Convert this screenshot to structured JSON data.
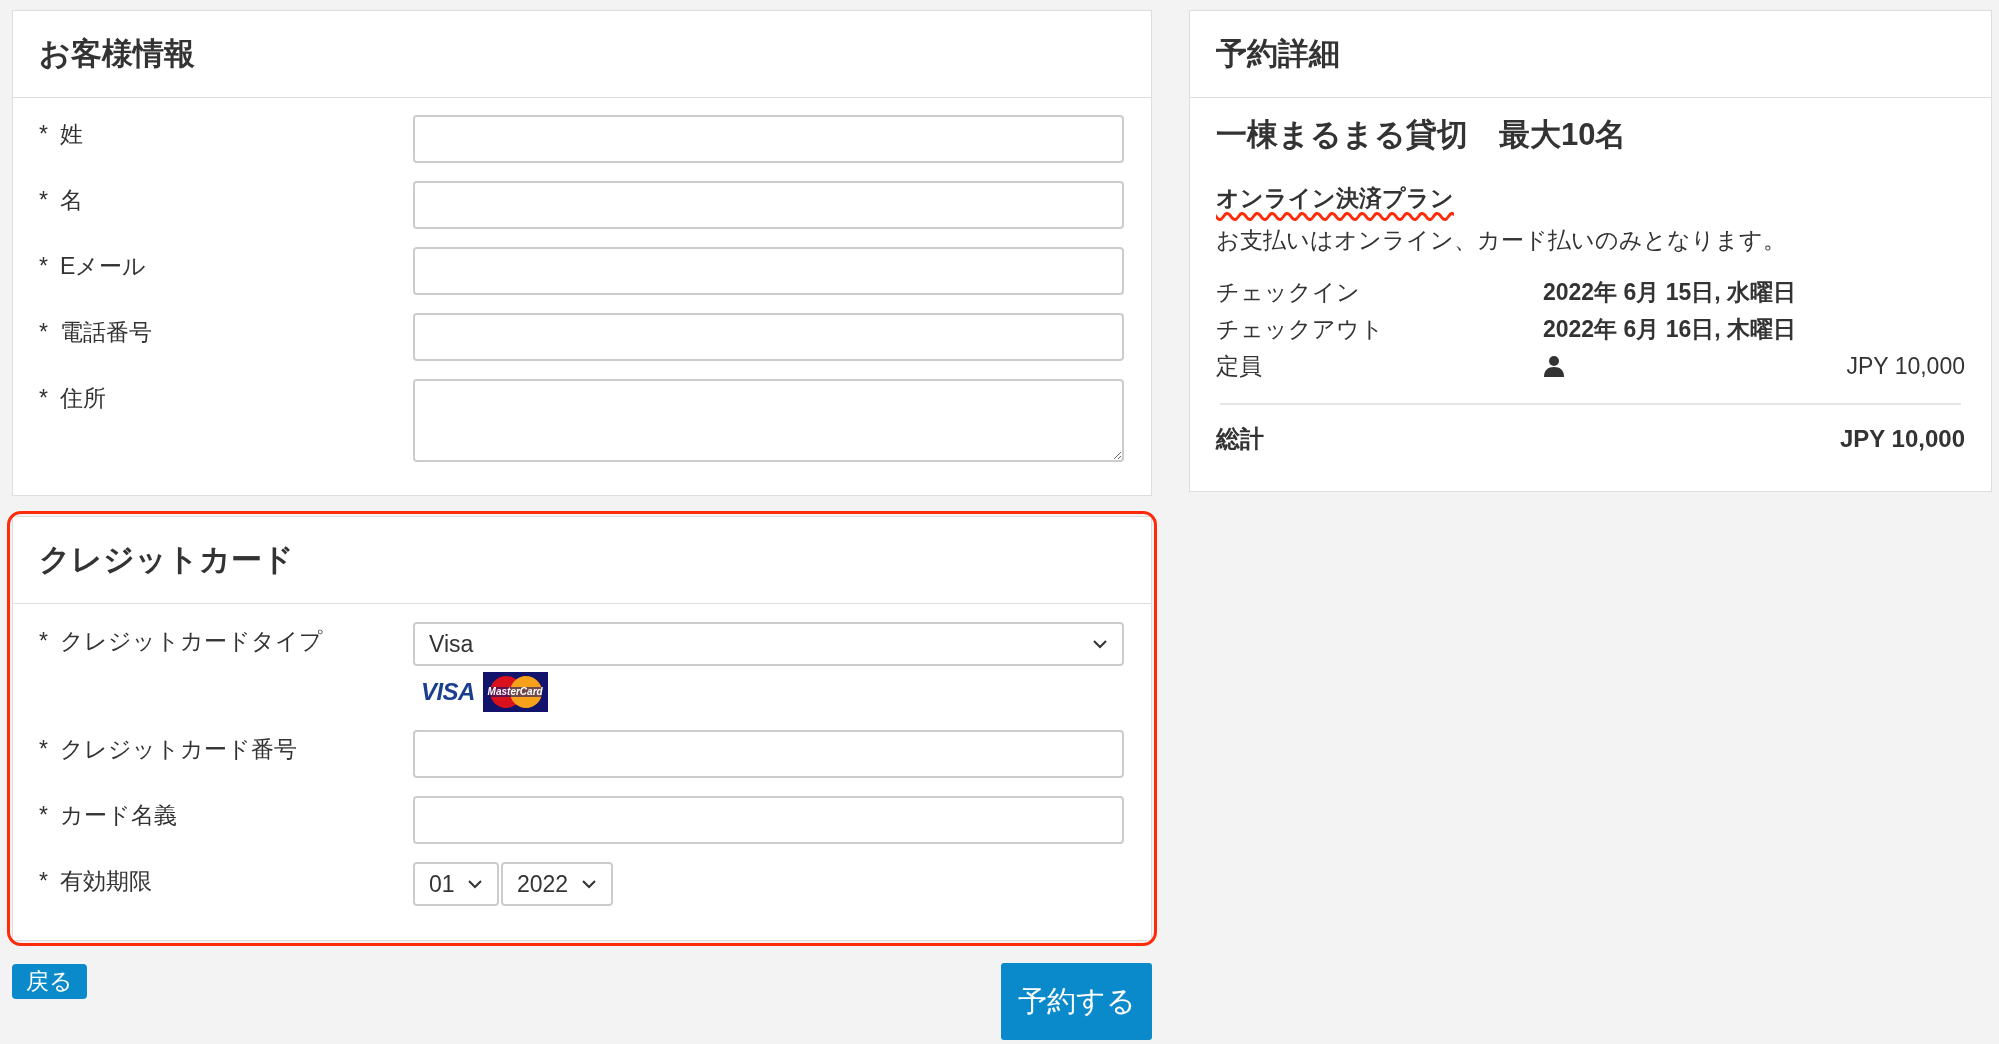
{
  "customer_panel": {
    "title": "お客様情報",
    "fields": [
      {
        "label": "姓",
        "required_mark": "*",
        "kind": "text"
      },
      {
        "label": "名",
        "required_mark": "*",
        "kind": "text"
      },
      {
        "label": "Eメール",
        "required_mark": "*",
        "kind": "text"
      },
      {
        "label": "電話番号",
        "required_mark": "*",
        "kind": "text"
      },
      {
        "label": "住所",
        "required_mark": "*",
        "kind": "textarea"
      }
    ]
  },
  "credit_card_panel": {
    "title": "クレジットカード",
    "highlighted": true,
    "fields": [
      {
        "label": "クレジットカードタイプ",
        "required_mark": "*",
        "kind": "select",
        "value": "Visa"
      },
      {
        "label": "クレジットカード番号",
        "required_mark": "*",
        "kind": "text"
      },
      {
        "label": "カード名義",
        "required_mark": "*",
        "kind": "text"
      },
      {
        "label": "有効期限",
        "required_mark": "*",
        "kind": "expiry",
        "month": "01",
        "year": "2022"
      }
    ],
    "card_logos": [
      {
        "kind": "visa",
        "label": "VISA"
      },
      {
        "kind": "mastercard",
        "label": "MasterCard"
      }
    ]
  },
  "back_button": "戻る",
  "submit_button": "予約する",
  "reservation_panel": {
    "title": "予約詳細",
    "room": "一棟まるまる貸切　最大10名",
    "plan": "オンライン決済プラン",
    "plan_highlighted": true,
    "note": "お支払いはオンライン、カード払いのみとなります。",
    "rows": [
      {
        "label": "チェックイン",
        "value": "2022年 6月 15日, 水曜日",
        "kind": "date"
      },
      {
        "label": "チェックアウト",
        "value": "2022年 6月 16日, 木曜日",
        "kind": "date"
      },
      {
        "label": "定員",
        "value": "JPY 10,000",
        "kind": "guests"
      }
    ],
    "total_label": "総計",
    "total_value": "JPY 10,000"
  }
}
